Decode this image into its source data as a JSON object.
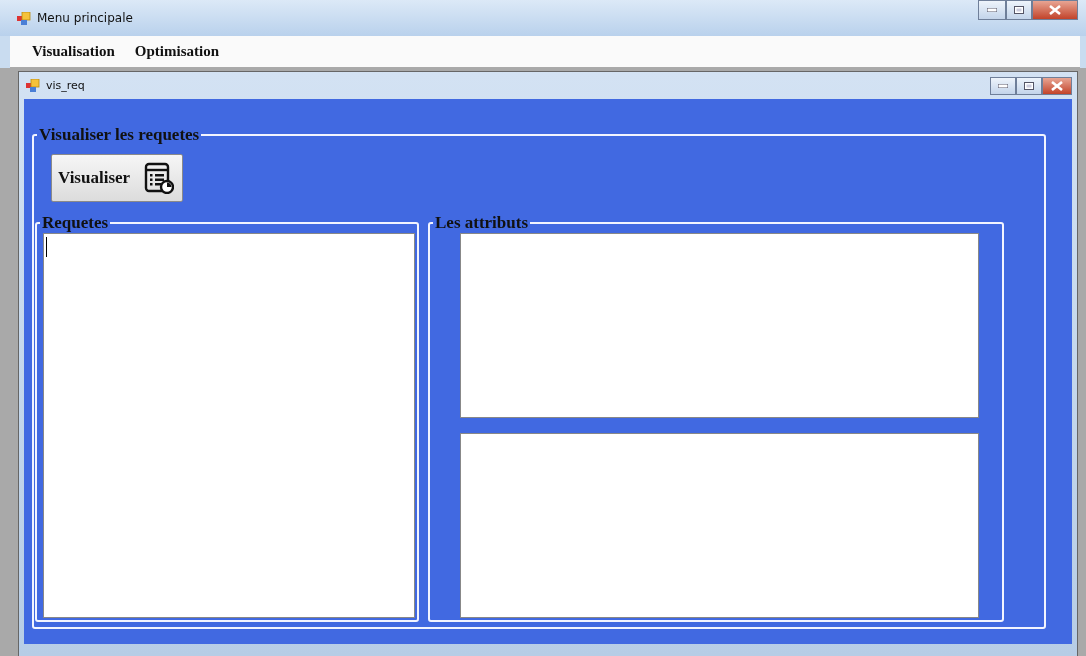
{
  "window": {
    "title": "Menu principale"
  },
  "menu": [
    {
      "label": "Visualisation"
    },
    {
      "label": "Optimisation"
    }
  ],
  "child_window": {
    "title": "vis_req"
  },
  "main_group": {
    "title": "Visualiser les requetes",
    "button": "Visualiser"
  },
  "requetes": {
    "title": "Requetes",
    "list_box": {
      "focused": true
    }
  },
  "attributs": {
    "title": "Les attributs",
    "boxes": [
      {
        "kind": "text_area"
      },
      {
        "kind": "text_area"
      }
    ]
  }
}
